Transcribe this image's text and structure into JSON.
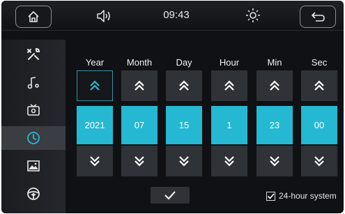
{
  "status_bar": {
    "time": "09:43"
  },
  "icons": {
    "home": "home-icon",
    "volume": "volume-icon",
    "brightness": "brightness-icon",
    "back": "back-icon"
  },
  "sidebar": {
    "items": [
      {
        "icon": "tools-icon",
        "active": false
      },
      {
        "icon": "music-settings-icon",
        "active": false
      },
      {
        "icon": "tv-settings-icon",
        "active": false
      },
      {
        "icon": "clock-icon",
        "active": true
      },
      {
        "icon": "image-icon",
        "active": false
      },
      {
        "icon": "steering-wheel-icon",
        "active": false
      }
    ]
  },
  "date_time": {
    "columns": [
      {
        "label": "Year",
        "value": "2021"
      },
      {
        "label": "Month",
        "value": "07"
      },
      {
        "label": "Day",
        "value": "15"
      },
      {
        "label": "Hour",
        "value": "1"
      },
      {
        "label": "Min",
        "value": "23"
      },
      {
        "label": "Sec",
        "value": "00"
      }
    ]
  },
  "hour_format": {
    "label": "24-hour system",
    "checked": true
  },
  "colors": {
    "accent": "#25b8d2",
    "panel": "#2f3236",
    "background": "#101114"
  }
}
